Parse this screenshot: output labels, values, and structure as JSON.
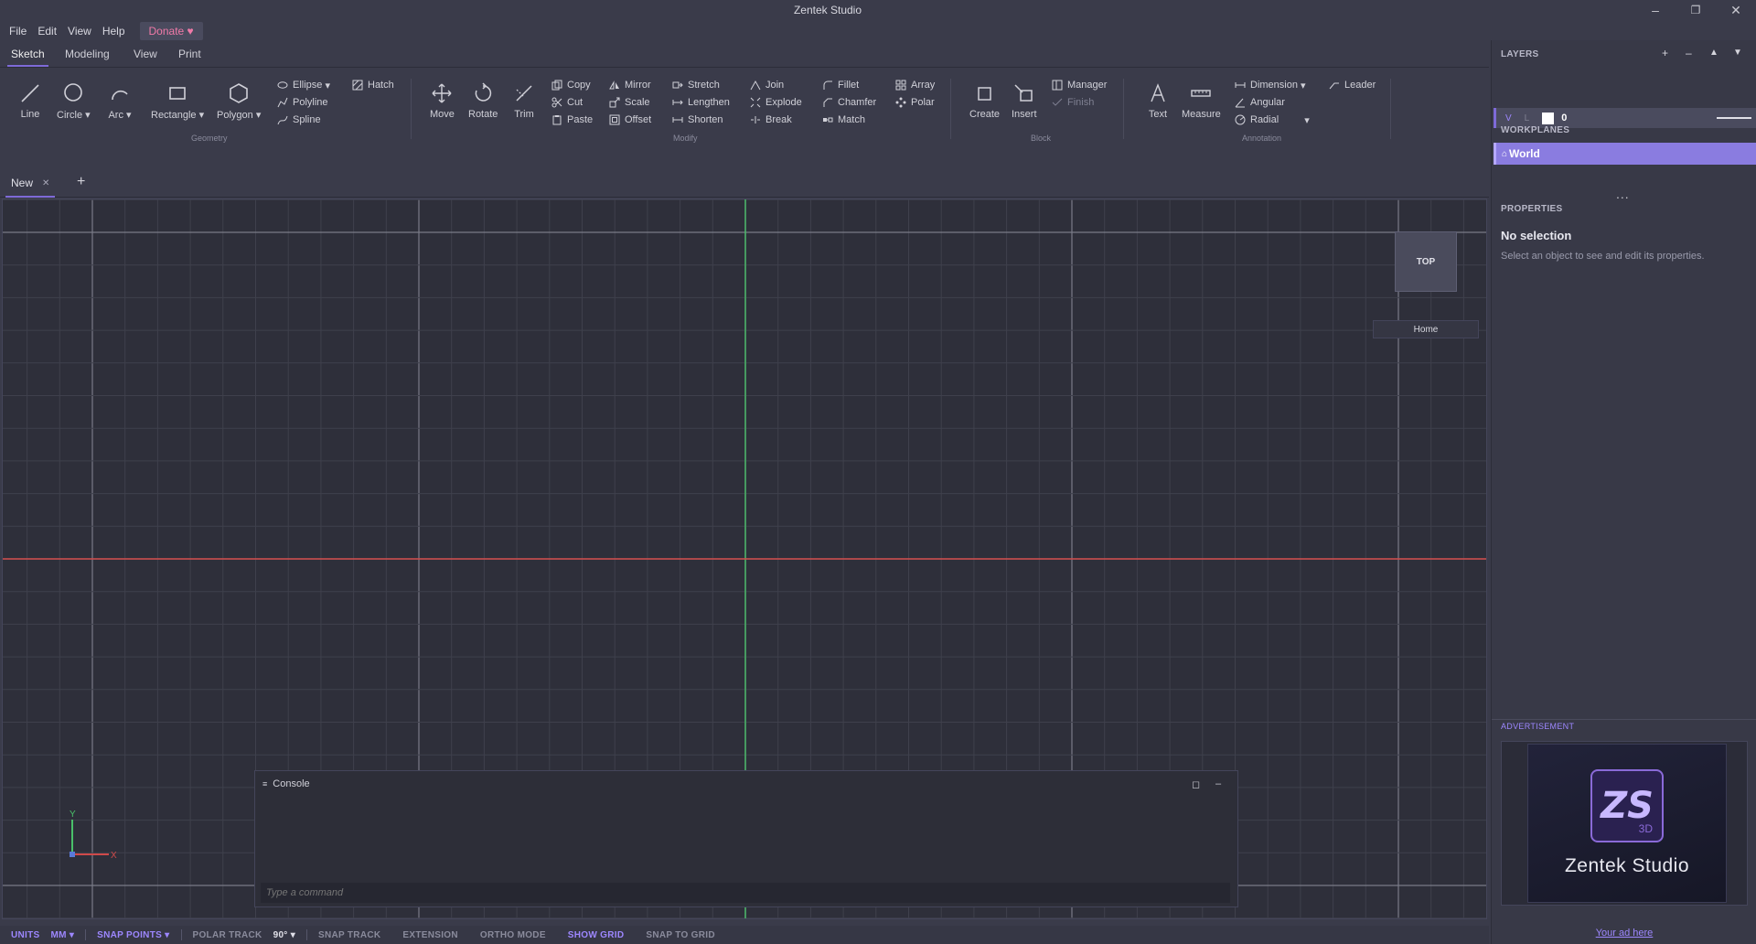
{
  "app": {
    "title": "Zentek Studio"
  },
  "window_controls": {
    "minimize": "–",
    "restore": "❐",
    "close": "✕"
  },
  "menu": {
    "file": "File",
    "edit": "Edit",
    "view": "View",
    "help": "Help",
    "donate": "Donate ♥"
  },
  "ribbon_tabs": {
    "sketch": "Sketch",
    "modeling": "Modeling",
    "view": "View",
    "print": "Print"
  },
  "ribbon": {
    "geometry": {
      "label": "Geometry",
      "line": "Line",
      "circle": "Circle",
      "arc": "Arc",
      "rectangle": "Rectangle",
      "polygon": "Polygon",
      "ellipse": "Ellipse",
      "polyline": "Polyline",
      "spline": "Spline",
      "hatch": "Hatch"
    },
    "modify": {
      "label": "Modify",
      "move": "Move",
      "rotate": "Rotate",
      "trim": "Trim",
      "copy": "Copy",
      "cut": "Cut",
      "paste": "Paste",
      "mirror": "Mirror",
      "scale": "Scale",
      "offset": "Offset",
      "stretch": "Stretch",
      "lengthen": "Lengthen",
      "shorten": "Shorten",
      "join": "Join",
      "explode": "Explode",
      "break": "Break",
      "fillet": "Fillet",
      "chamfer": "Chamfer",
      "match": "Match",
      "array": "Array",
      "polar": "Polar"
    },
    "block": {
      "label": "Block",
      "create": "Create",
      "insert": "Insert",
      "manager": "Manager",
      "finish": "Finish"
    },
    "annotation": {
      "label": "Annotation",
      "text": "Text",
      "measure": "Measure",
      "dimension": "Dimension",
      "angular": "Angular",
      "radial": "Radial",
      "leader": "Leader"
    }
  },
  "document_tabs": {
    "active": "New",
    "close": "✕",
    "add": "+"
  },
  "viewport": {
    "view_cube": "TOP",
    "home": "Home",
    "axis_x": "X",
    "axis_y": "Y"
  },
  "console": {
    "title": "Console",
    "placeholder": "Type a command"
  },
  "statusbar": {
    "units": "UNITS",
    "units_value": "MM",
    "snap_points": "SNAP POINTS",
    "polar_track": "POLAR TRACK",
    "angle": "90°",
    "snap_track": "SNAP TRACK",
    "extension": "EXTENSION",
    "ortho_mode": "ORTHO MODE",
    "show_grid": "SHOW GRID",
    "snap_to_grid": "SNAP TO GRID"
  },
  "layers": {
    "title": "LAYERS",
    "add": "+",
    "remove": "–",
    "up": "▲",
    "down": "▼",
    "rows": [
      {
        "visible": "V",
        "locked": "L",
        "name": "0"
      }
    ],
    "more": "..."
  },
  "workplanes": {
    "title": "WORKPLANES",
    "items": [
      {
        "name": "World"
      }
    ],
    "more": "..."
  },
  "properties": {
    "title": "PROPERTIES",
    "empty_title": "No selection",
    "empty_hint": "Select an object to see and edit its properties."
  },
  "advertisement": {
    "label": "ADVERTISEMENT",
    "logo_text": "ZS",
    "logo_sub": "3D",
    "brand": "Zentek Studio",
    "link": "Your ad here"
  },
  "colors": {
    "accent": "#9d87ff",
    "x_axis": "#d04a4a",
    "y_axis": "#4ac06a",
    "donate": "#f07aa8"
  }
}
